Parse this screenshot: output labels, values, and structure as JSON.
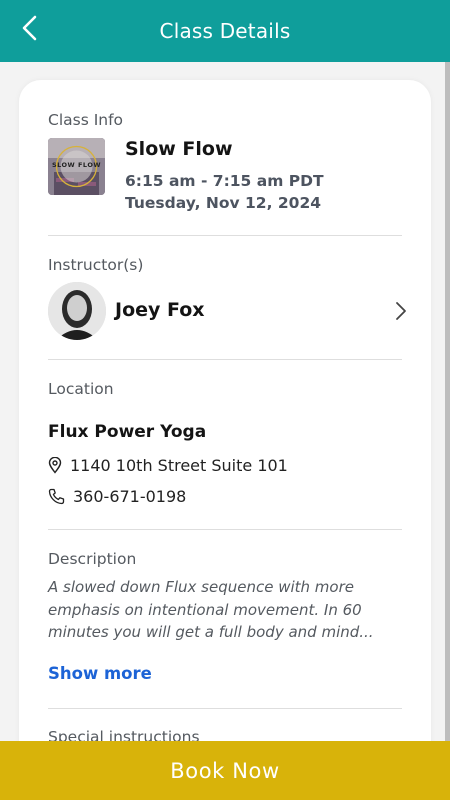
{
  "header": {
    "title": "Class Details"
  },
  "class_info": {
    "label": "Class Info",
    "thumbnail_text": "SLOW FLOW",
    "name": "Slow Flow",
    "time": "6:15 am - 7:15 am PDT",
    "date": "Tuesday, Nov 12, 2024"
  },
  "instructor": {
    "label": "Instructor(s)",
    "name": "Joey Fox"
  },
  "location": {
    "label": "Location",
    "name": "Flux Power Yoga",
    "address": "1140 10th Street Suite 101",
    "phone": "360-671-0198"
  },
  "description": {
    "label": "Description",
    "text": "A slowed down Flux sequence with more emphasis on intentional movement. In 60 minutes you will get a full body and mind...",
    "show_more": "Show more"
  },
  "special_instructions": {
    "label": "Special instructions"
  },
  "footer": {
    "book_label": "Book Now"
  },
  "colors": {
    "header": "#0f9e9b",
    "book": "#d8b30a",
    "link": "#1c63d6"
  }
}
